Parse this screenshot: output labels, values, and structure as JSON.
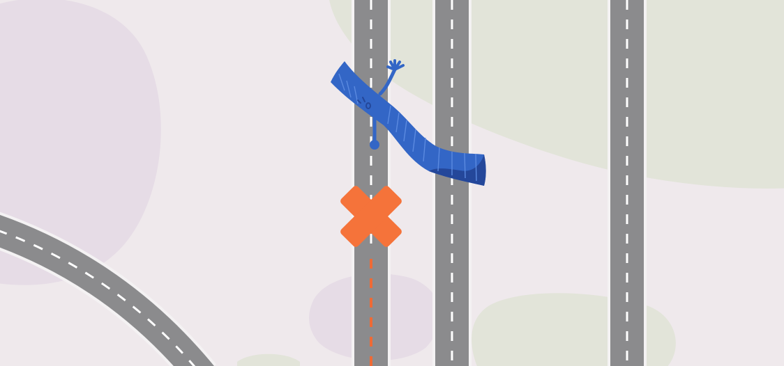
{
  "scene": {
    "background_color": "#efe9ec",
    "blob_purple_color": "#e6dce6",
    "blob_green_color": "#e2e4d9",
    "road_color": "#8b8b8d",
    "road_edge_color": "#f4f2f3",
    "lane_mark_color": "#ffffff",
    "blocked_lane_color": "#ef6a35",
    "blocked_marker_color": "#f5733a",
    "character_color": "#3366c6",
    "character_highlight_color": "#5b8ae0",
    "character_shadow_color": "#24479a"
  },
  "elements": {
    "left-road-curve": "road",
    "road-1": "road",
    "road-2": "road",
    "road-3": "road",
    "blocked-marker": "x-mark-icon",
    "ribbon-character": "ribbon-mascot-icon"
  }
}
